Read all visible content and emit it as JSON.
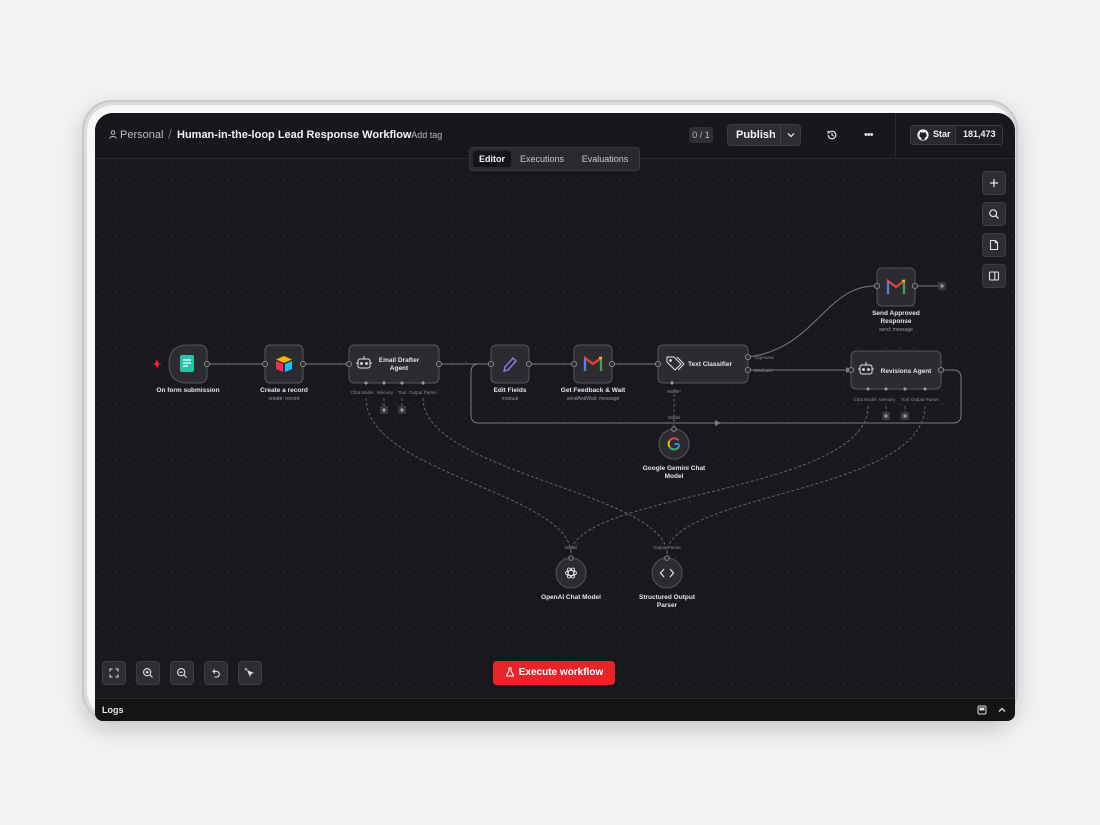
{
  "header": {
    "project": "Personal",
    "workflow_name": "Human-in-the-loop Lead Response Workflow",
    "add_tag": "+ Add tag",
    "counter": "0 / 1",
    "publish": "Publish",
    "github_star": "Star",
    "github_count": "181,473"
  },
  "tabs": [
    "Editor",
    "Executions",
    "Evaluations"
  ],
  "nodes": {
    "trigger": {
      "label": "On form submission"
    },
    "create_record": {
      "label": "Create a record",
      "sub": "create: record"
    },
    "email_drafter": {
      "label1": "Email Drafter",
      "label2": "Agent"
    },
    "edit_fields": {
      "label": "Edit Fields",
      "sub": "manual"
    },
    "get_feedback": {
      "label": "Get Feedback & Wait",
      "sub": "sendAndWait: message"
    },
    "text_classifier": {
      "label": "Text Classifier"
    },
    "send_approved": {
      "label1": "Send Approved",
      "label2": "Response",
      "sub": "send: message"
    },
    "revisions_agent": {
      "label": "Revisions Agent"
    },
    "gemini": {
      "label1": "Google Gemini Chat",
      "label2": "Model"
    },
    "openai": {
      "label": "OpenAI Chat Model"
    },
    "parser": {
      "label1": "Structured Output",
      "label2": "Parser"
    }
  },
  "ports": {
    "chat_model": "Chat Model",
    "memory": "Memory",
    "tool": "Tool",
    "output_parser": "Output Parser",
    "model_required": "Model*",
    "model": "Model",
    "approved": "Approved",
    "declined": "Declined"
  },
  "execute": "Execute workflow",
  "logs": "Logs",
  "colors": {
    "execute": "#e8242b",
    "background": "#151417"
  }
}
